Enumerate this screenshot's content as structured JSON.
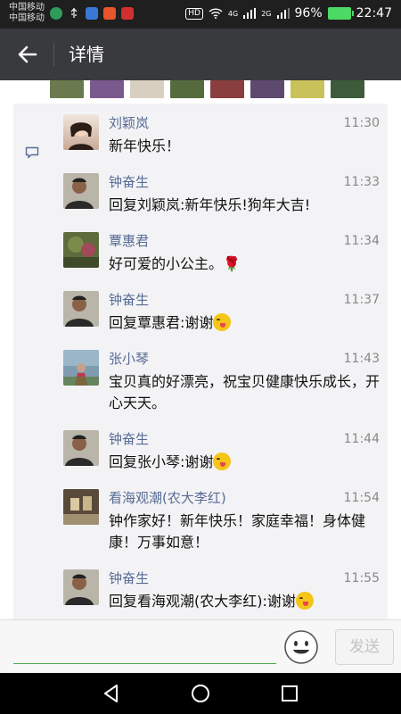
{
  "status_bar": {
    "carrier_1": "中国移动",
    "carrier_2": "中国移动",
    "network_hd": "HD",
    "net_1": "4G",
    "net_2": "2G",
    "battery_percent": "96%",
    "time": "22:47"
  },
  "header": {
    "title": "详情"
  },
  "comments": [
    {
      "name": "刘颖岚",
      "time": "11:30",
      "text": "新年快乐！"
    },
    {
      "name": "钟奋生",
      "time": "11:33",
      "text": "回复刘颖岚:新年快乐!狗年大吉!"
    },
    {
      "name": "覃惠君",
      "time": "11:34",
      "text": "好可爱的小公主。",
      "rose": "🌹"
    },
    {
      "name": "钟奋生",
      "time": "11:37",
      "text": "回复覃惠君:谢谢"
    },
    {
      "name": "张小琴",
      "time": "11:43",
      "text": "宝贝真的好漂亮，祝宝贝健康快乐成长，开心天天。"
    },
    {
      "name": "钟奋生",
      "time": "11:44",
      "text": "回复张小琴:谢谢"
    },
    {
      "name": "看海观潮(农大李红)",
      "time": "11:54",
      "text": "钟作家好！新年快乐！家庭幸福！身体健康！万事如意！"
    },
    {
      "name": "钟奋生",
      "time": "11:55",
      "text": "回复看海观潮(农大李红):谢谢"
    }
  ],
  "input_bar": {
    "placeholder": "",
    "send_label": "发送"
  },
  "colors": {
    "title_bar": "#393a3e",
    "name_link": "#576b95",
    "input_underline": "#4cae4c"
  },
  "icons": [
    "back-arrow-icon",
    "comment-icon",
    "emoji-icon",
    "nav-back-icon",
    "nav-home-icon",
    "nav-recents-icon"
  ]
}
